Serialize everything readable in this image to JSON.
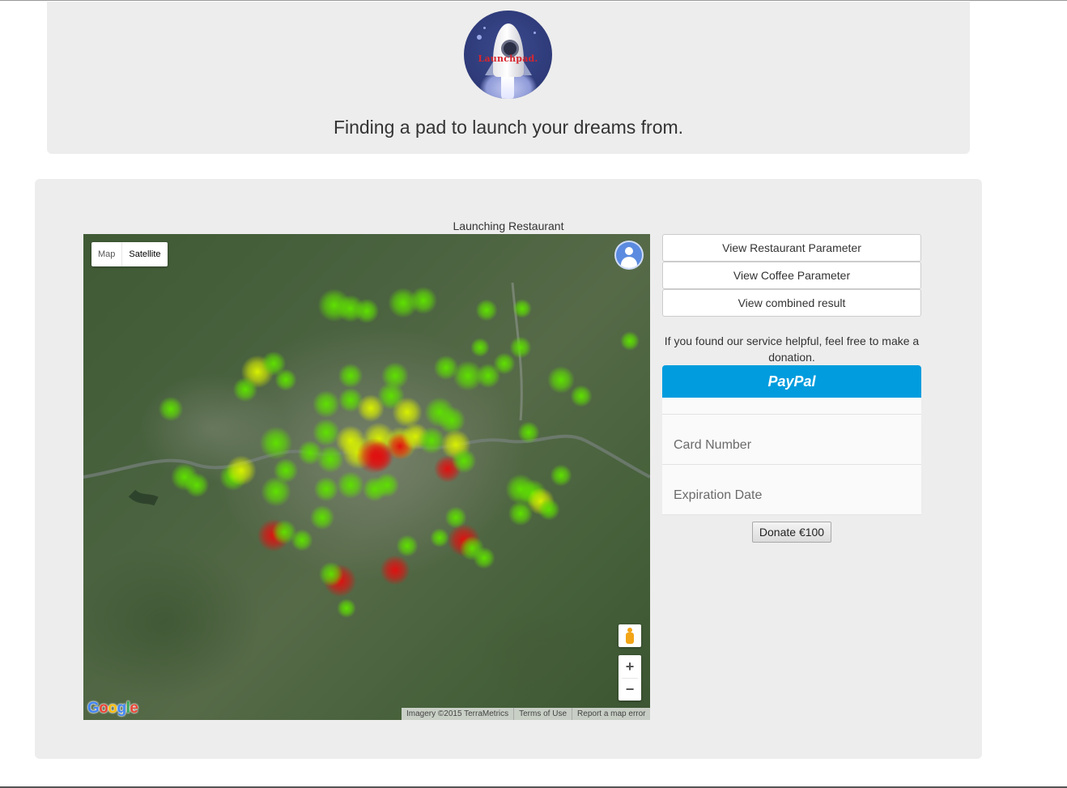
{
  "header": {
    "logo_text": "Launchpad.",
    "tagline": "Finding a pad to launch your dreams from."
  },
  "map": {
    "title": "Launching Restaurant",
    "type_control": {
      "map_label": "Map",
      "satellite_label": "Satellite",
      "selected": "Satellite"
    },
    "zoom_in": "+",
    "zoom_out": "−",
    "google_logo": "Google",
    "attribution": {
      "imagery": "Imagery ©2015 TerraMetrics",
      "terms": "Terms of Use",
      "report": "Report a map error"
    },
    "heatmap_colors": {
      "low": "#5ee000",
      "mid": "#d8f000",
      "high": "#e01010"
    }
  },
  "sidebar": {
    "buttons": [
      {
        "label": "View Restaurant Parameter"
      },
      {
        "label": "View Coffee Parameter"
      },
      {
        "label": "View combined result"
      }
    ],
    "donation_text": "If you found our service helpful, feel free to make a donation.",
    "paypal_label": "PayPal",
    "card_number_placeholder": "Card Number",
    "expiration_placeholder": "Expiration Date",
    "donate_button": "Donate €100"
  },
  "colors": {
    "panel_bg": "#ededed",
    "paypal_blue": "#009cde"
  }
}
